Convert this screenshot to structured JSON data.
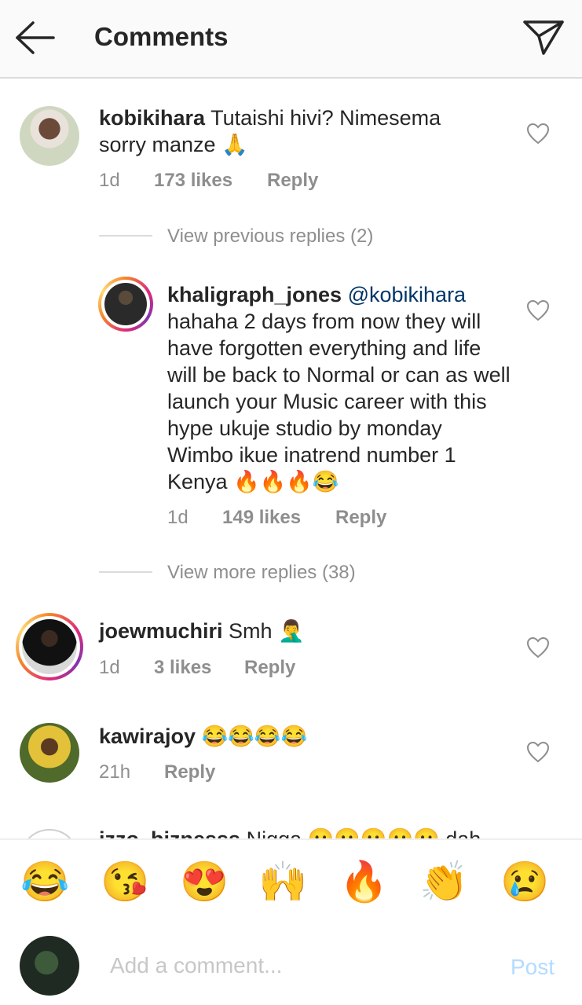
{
  "header": {
    "title": "Comments",
    "back_icon": "arrow-left-icon",
    "send_icon": "paper-plane-icon"
  },
  "comments": [
    {
      "username": "kobikihara",
      "text": "Tutaishi hivi? Nimesema sorry manze 🙏",
      "time": "1d",
      "likes": "173 likes",
      "reply": "Reply"
    },
    {
      "username": "khaligraph_jones",
      "mention": "@kobikihara",
      "text": "hahaha 2 days from now they will have forgotten everything and life will be back to Normal or can as well launch your Music career with this hype ukuje studio by monday Wimbo ikue inatrend number 1 Kenya 🔥🔥🔥😂",
      "time": "1d",
      "likes": "149 likes",
      "reply": "Reply"
    },
    {
      "username": "joewmuchiri",
      "text": "Smh 🤦‍♂️",
      "time": "1d",
      "likes": "3 likes",
      "reply": "Reply"
    },
    {
      "username": "kawirajoy",
      "text": "😂😂😂😂",
      "time": "21h",
      "reply": "Reply"
    },
    {
      "username": "izzo_biznesss",
      "text": "Nigga 😐😐😐😐😐 dah"
    }
  ],
  "view_previous": "View previous replies (2)",
  "view_more": "View more replies (38)",
  "quick_emojis": [
    "😂",
    "😘",
    "😍",
    "🙌",
    "🔥",
    "👏",
    "😢"
  ],
  "input": {
    "placeholder": "Add a comment...",
    "post_label": "Post"
  },
  "colors": {
    "username": "#262626",
    "meta": "#8e8e8e",
    "mention": "#003569",
    "post_disabled": "#b3dbff",
    "header_bg": "#fafafa"
  }
}
